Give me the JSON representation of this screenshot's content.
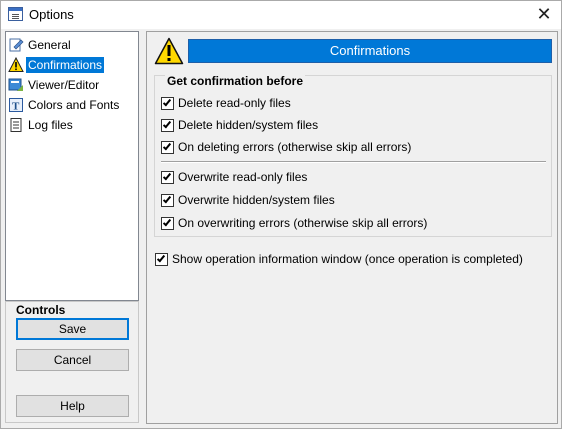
{
  "window": {
    "title": "Options",
    "close_glyph": "✕"
  },
  "tree": {
    "items": [
      {
        "label": "General",
        "icon": "general-page-icon",
        "selected": false
      },
      {
        "label": "Confirmations",
        "icon": "warning-icon",
        "selected": true
      },
      {
        "label": "Viewer/Editor",
        "icon": "viewer-editor-icon",
        "selected": false
      },
      {
        "label": "Colors and Fonts",
        "icon": "fonts-icon",
        "selected": false
      },
      {
        "label": "Log files",
        "icon": "log-file-icon",
        "selected": false
      }
    ]
  },
  "controls": {
    "title": "Controls",
    "save": "Save",
    "cancel": "Cancel",
    "help": "Help"
  },
  "panel": {
    "header": "Confirmations",
    "group_title": "Get confirmation before",
    "options": [
      {
        "label": "Delete read-only files",
        "checked": true
      },
      {
        "label": "Delete hidden/system files",
        "checked": true
      },
      {
        "label": "On deleting errors (otherwise skip all errors)",
        "checked": true
      },
      {
        "label": "Overwrite read-only files",
        "checked": true
      },
      {
        "label": "Overwrite hidden/system files",
        "checked": true
      },
      {
        "label": "On overwriting errors (otherwise skip all errors)",
        "checked": true
      }
    ],
    "show_info": {
      "label": "Show operation information window (once operation is completed)",
      "checked": true
    }
  },
  "colors": {
    "accent": "#0078d7",
    "warning": "#ffd800"
  }
}
